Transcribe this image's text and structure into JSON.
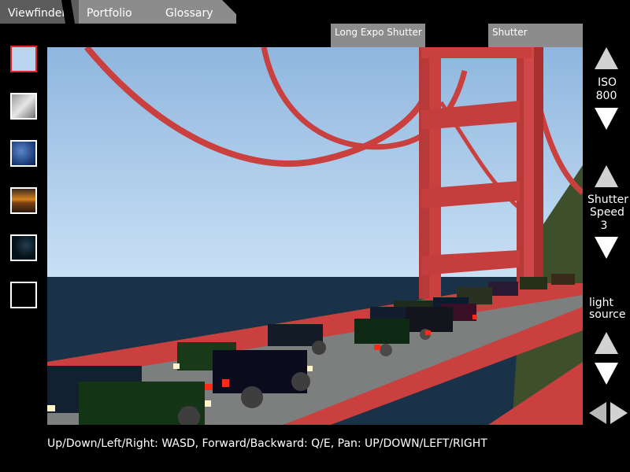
{
  "tabs": [
    {
      "label": "Viewfinder",
      "active": true
    },
    {
      "label": "Portfolio",
      "active": false
    },
    {
      "label": "Glossary",
      "active": false
    }
  ],
  "modes": {
    "long_expo": "Long Expo Shutter",
    "shutter": "Shutter"
  },
  "filters": [
    {
      "name": "clear-sky",
      "selected": true
    },
    {
      "name": "cloudy"
    },
    {
      "name": "blue-sky"
    },
    {
      "name": "sunset"
    },
    {
      "name": "night-sky"
    },
    {
      "name": "none"
    }
  ],
  "controls": {
    "iso": {
      "label": "ISO",
      "value": "800"
    },
    "shutter_speed": {
      "label_line1": "Shutter",
      "label_line2": "Speed",
      "value": "3"
    },
    "light_source": {
      "label_line1": "light",
      "label_line2": "source"
    }
  },
  "hint": "Up/Down/Left/Right: WASD, Forward/Backward: Q/E, Pan: UP/DOWN/LEFT/RIGHT",
  "colors": {
    "bridge": "#c9403f",
    "sky_top": "#8fb6de",
    "sky_bottom": "#c6def4",
    "sea": "#193248",
    "selected_border": "#e0242a"
  }
}
